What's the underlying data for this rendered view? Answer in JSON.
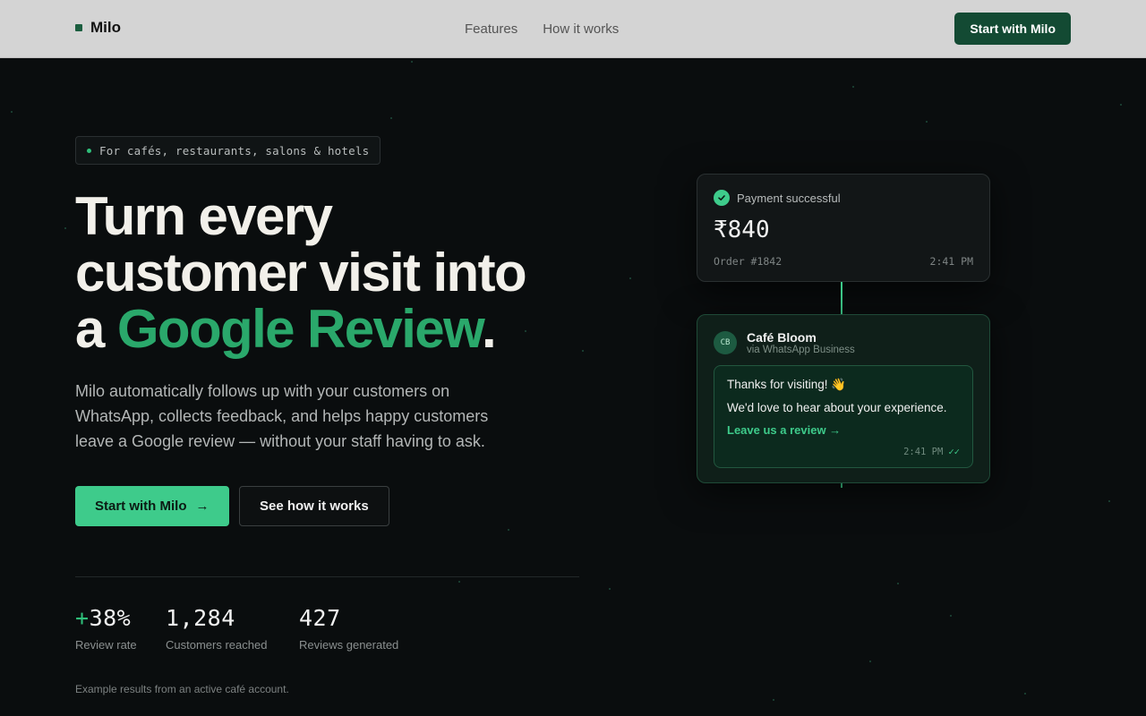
{
  "nav": {
    "brand": "Milo",
    "links": [
      "Features",
      "How it works"
    ],
    "cta": "Start with Milo"
  },
  "hero": {
    "pill": "For cafés, restaurants, salons & hotels",
    "headline_line1": "Turn every",
    "headline_line2": "customer visit into",
    "headline_prefix": "a ",
    "headline_accent": "Google Review",
    "headline_suffix": ".",
    "lead": "Milo automatically follows up with your customers on WhatsApp, collects feedback, and helps happy customers leave a Google review — without your staff having to ask.",
    "primary_cta": "Start with Milo",
    "primary_cta_arrow": "→",
    "secondary_cta": "See how it works"
  },
  "stats": [
    {
      "plus": "+",
      "value": "38%",
      "label": "Review rate"
    },
    {
      "value": "1,284",
      "label": "Customers reached"
    },
    {
      "value": "427",
      "label": "Reviews generated"
    }
  ],
  "footnote": "Example results from an active café account.",
  "payment_card": {
    "title": "Payment successful",
    "amount": "₹840",
    "order": "Order #1842",
    "time": "2:41 PM"
  },
  "whatsapp_card": {
    "avatar": "CB",
    "name": "Café Bloom",
    "via": "via WhatsApp Business",
    "line1": "Thanks for visiting! 👋",
    "line2": "We'd love to hear about your experience.",
    "link": "Leave us a review →",
    "time": "2:41 PM",
    "ticks": "✓✓"
  },
  "colors": {
    "background": "#0a0d0e",
    "accent": "#3ecb8b",
    "headline_accent": "#2aa86b",
    "nav_cta": "#134a33"
  }
}
